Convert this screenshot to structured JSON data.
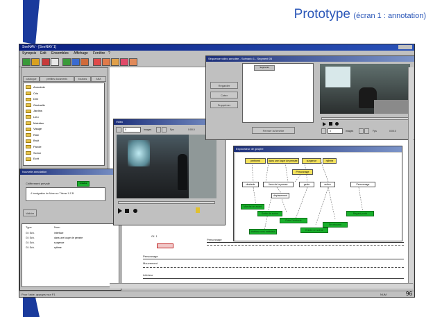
{
  "slide": {
    "title": "Prototype",
    "subtitle": "(écran 1 : annotation)",
    "page_number": "96",
    "accent_color": "#1a3a9c"
  },
  "app": {
    "window_title": "SeeNAV - [SeeNAV 1]",
    "menu": [
      "Synopsis",
      "Edit",
      "Ensembles",
      "Affichage",
      "Fenêtre",
      "?"
    ],
    "status": "Pour l'aide, appuyez sur F1",
    "status_right": "NUM"
  },
  "browser": {
    "tabs": [
      "catalogue",
      "perifiles documents",
      "boutons",
      "ANA"
    ],
    "folders": [
      "Anecdote",
      "Cris",
      "Dire",
      "Gestuelle",
      "Jardins",
      "Lieu",
      "Maintien",
      "Visage",
      "Rôle",
      "Bruit",
      "Parole",
      "Scène",
      "Ecrit"
    ]
  },
  "annotation_panel": {
    "title": "Nouvelle annotation",
    "label": "Chiffrement prévalé",
    "status": "Initialisé",
    "text": "4 Immigration de Mme sur Thème 1-Z-B",
    "button": "Valider",
    "headers": [
      "Type",
      "Nom"
    ],
    "rows": [
      [
        "Gf. Sch.",
        "interface"
      ],
      [
        "Gf. Sch.",
        "dans une loupe de pensée"
      ],
      [
        "Gf. Sch.",
        "surgence"
      ],
      [
        "Gf. Sch.",
        "rythme"
      ]
    ]
  },
  "video_small": {
    "title": "Vidéo",
    "frame": "0",
    "unit": "images",
    "fps": "Fps",
    "time": "0:00.0"
  },
  "video_top": {
    "title": "Séquence vidéo annotée - Scénario 1 - Segment 05",
    "list_label": "Segments",
    "side_buttons": [
      "Regarder",
      "Créer",
      "Supprimer"
    ],
    "bottom_button": "Fermer la fenêtre",
    "frame": "0",
    "unit": "images",
    "fps": "Fps",
    "time": "0:00.0"
  },
  "explorer": {
    "title": "Explorateur de graphe",
    "yellow_nodes": [
      "pertinent",
      "dans une loupe de pensée",
      "surgence",
      "rythme",
      "Personnage"
    ],
    "white_nodes": [
      "obstacle",
      "liens de la presse",
      "geste",
      "action",
      "Personnage",
      "déplacement"
    ],
    "green_nodes": [
      "Marche en avant",
      "Sortie de scène",
      "Évite l'obstacle",
      "Entrée en scène",
      "Se retourne",
      "Regard porté",
      "Intérieur vers extérieur"
    ]
  },
  "timeline": {
    "label": "Personnage",
    "sub_labels": [
      "Personnage",
      "Mouvement",
      "Gf. 1",
      "Intérieur"
    ]
  }
}
